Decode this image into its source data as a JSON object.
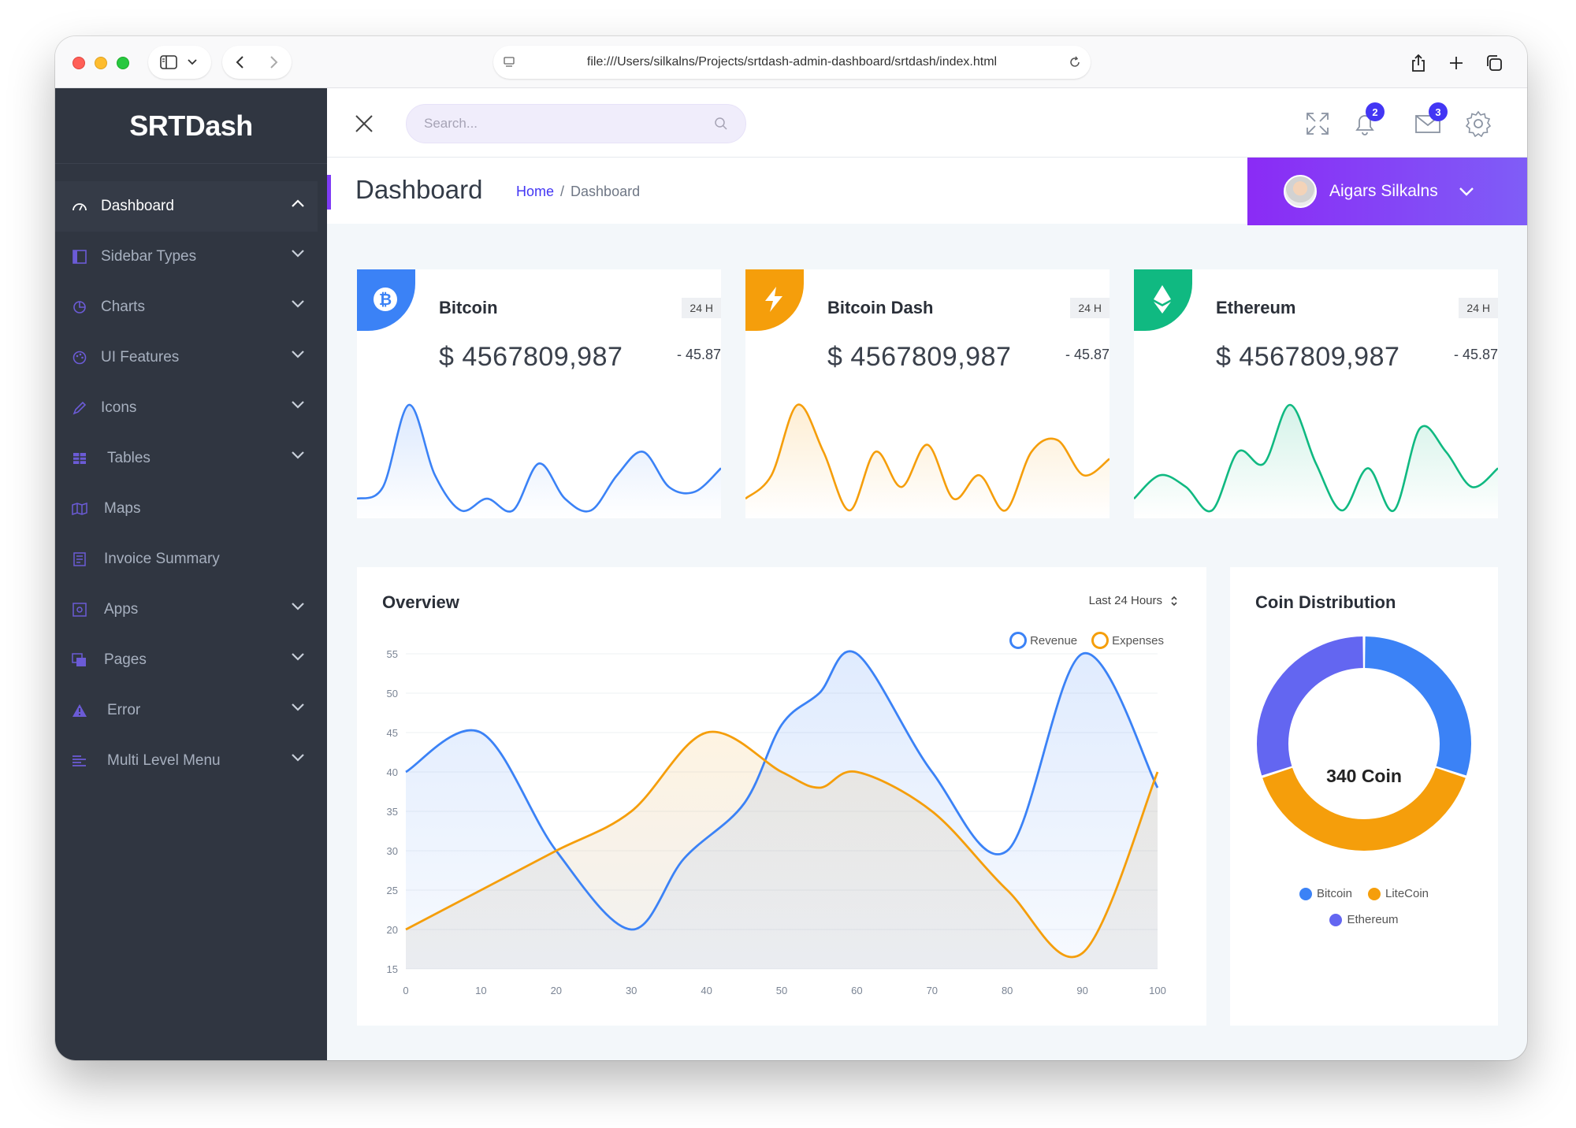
{
  "browser": {
    "url": "file:///Users/silkalns/Projects/srtdash-admin-dashboard/srtdash/index.html"
  },
  "sidebar": {
    "logo": "SRTDash",
    "items": [
      {
        "label": "Dashboard",
        "icon": "dashboard-icon",
        "active": true
      },
      {
        "label": "Sidebar Types",
        "icon": "sidebar-icon"
      },
      {
        "label": "Charts",
        "icon": "pie-chart-icon"
      },
      {
        "label": "UI Features",
        "icon": "palette-icon"
      },
      {
        "label": "Icons",
        "icon": "pen-icon"
      },
      {
        "label": "Tables",
        "icon": "table-icon"
      },
      {
        "label": "Maps",
        "icon": "map-icon"
      },
      {
        "label": "Invoice Summary",
        "icon": "invoice-icon"
      },
      {
        "label": "Apps",
        "icon": "apps-icon"
      },
      {
        "label": "Pages",
        "icon": "pages-icon"
      },
      {
        "label": "Error",
        "icon": "warning-icon"
      },
      {
        "label": "Multi Level Menu",
        "icon": "list-icon"
      }
    ]
  },
  "header": {
    "search_placeholder": "Search...",
    "notifications_count": "2",
    "messages_count": "3"
  },
  "page": {
    "title": "Dashboard",
    "breadcrumb_home": "Home",
    "breadcrumb_sep": "/",
    "breadcrumb_current": "Dashboard"
  },
  "user": {
    "name": "Aigars Silkalns"
  },
  "coins": [
    {
      "name": "Bitcoin",
      "period": "24 H",
      "price": "$ 4567809,987",
      "change": "- 45.87",
      "color": "#3b82f6",
      "fill": "#e8f0fe",
      "icon": "bitcoin-icon"
    },
    {
      "name": "Bitcoin Dash",
      "period": "24 H",
      "price": "$ 4567809,987",
      "change": "- 45.87",
      "color": "#f59e0b",
      "fill": "#fdf1e1",
      "icon": "lightning-icon"
    },
    {
      "name": "Ethereum",
      "period": "24 H",
      "price": "$ 4567809,987",
      "change": "- 45.87",
      "color": "#10b981",
      "fill": "#e4f6ee",
      "icon": "ethereum-icon"
    }
  ],
  "overview": {
    "title": "Overview",
    "range": "Last 24 Hours",
    "legend_revenue": "Revenue",
    "legend_expenses": "Expenses"
  },
  "distribution": {
    "title": "Coin Distribution",
    "center": "340 Coin",
    "legend_bitcoin": "Bitcoin",
    "legend_litecoin": "LiteCoin",
    "legend_ethereum": "Ethereum"
  },
  "chart_data": [
    {
      "type": "area",
      "title": "Overview",
      "x": [
        0,
        10,
        20,
        30,
        40,
        50,
        60,
        70,
        80,
        90,
        100
      ],
      "xlim": [
        0,
        100
      ],
      "ylim": [
        15,
        55
      ],
      "yticks": [
        15,
        20,
        25,
        30,
        35,
        40,
        45,
        50,
        55
      ],
      "series": [
        {
          "name": "Revenue",
          "color": "#3b82f6",
          "points": [
            [
              0,
              40
            ],
            [
              10,
              45
            ],
            [
              20,
              30
            ],
            [
              30,
              20
            ],
            [
              37,
              29
            ],
            [
              45,
              36
            ],
            [
              50,
              46
            ],
            [
              55,
              50
            ],
            [
              60,
              55
            ],
            [
              70,
              40
            ],
            [
              80,
              30
            ],
            [
              90,
              55
            ],
            [
              100,
              38
            ]
          ]
        },
        {
          "name": "Expenses",
          "color": "#f59e0b",
          "points": [
            [
              0,
              20
            ],
            [
              10,
              25
            ],
            [
              20,
              30
            ],
            [
              30,
              35
            ],
            [
              40,
              45
            ],
            [
              50,
              40
            ],
            [
              55,
              38
            ],
            [
              60,
              40
            ],
            [
              70,
              35
            ],
            [
              80,
              25
            ],
            [
              90,
              17
            ],
            [
              100,
              40
            ]
          ]
        }
      ]
    },
    {
      "type": "pie",
      "title": "Coin Distribution",
      "center_label": "340 Coin",
      "labels": [
        "Bitcoin",
        "LiteCoin",
        "Ethereum"
      ],
      "values": [
        30,
        40,
        30
      ],
      "colors": [
        "#3b82f6",
        "#f59e0b",
        "#6366f1"
      ]
    },
    {
      "type": "area",
      "title": "",
      "series": [
        {
          "name": "Bitcoin",
          "values": [
            5,
            10,
            45,
            15,
            0,
            5,
            0,
            20,
            5,
            0,
            15,
            25,
            10,
            8,
            18
          ]
        },
        {
          "name": "Bitcoin Dash",
          "values": [
            5,
            15,
            45,
            25,
            0,
            25,
            10,
            28,
            5,
            15,
            0,
            25,
            30,
            15,
            22
          ]
        },
        {
          "name": "Ethereum",
          "values": [
            5,
            15,
            10,
            0,
            25,
            20,
            45,
            20,
            0,
            18,
            0,
            35,
            25,
            10,
            18
          ]
        }
      ]
    }
  ]
}
